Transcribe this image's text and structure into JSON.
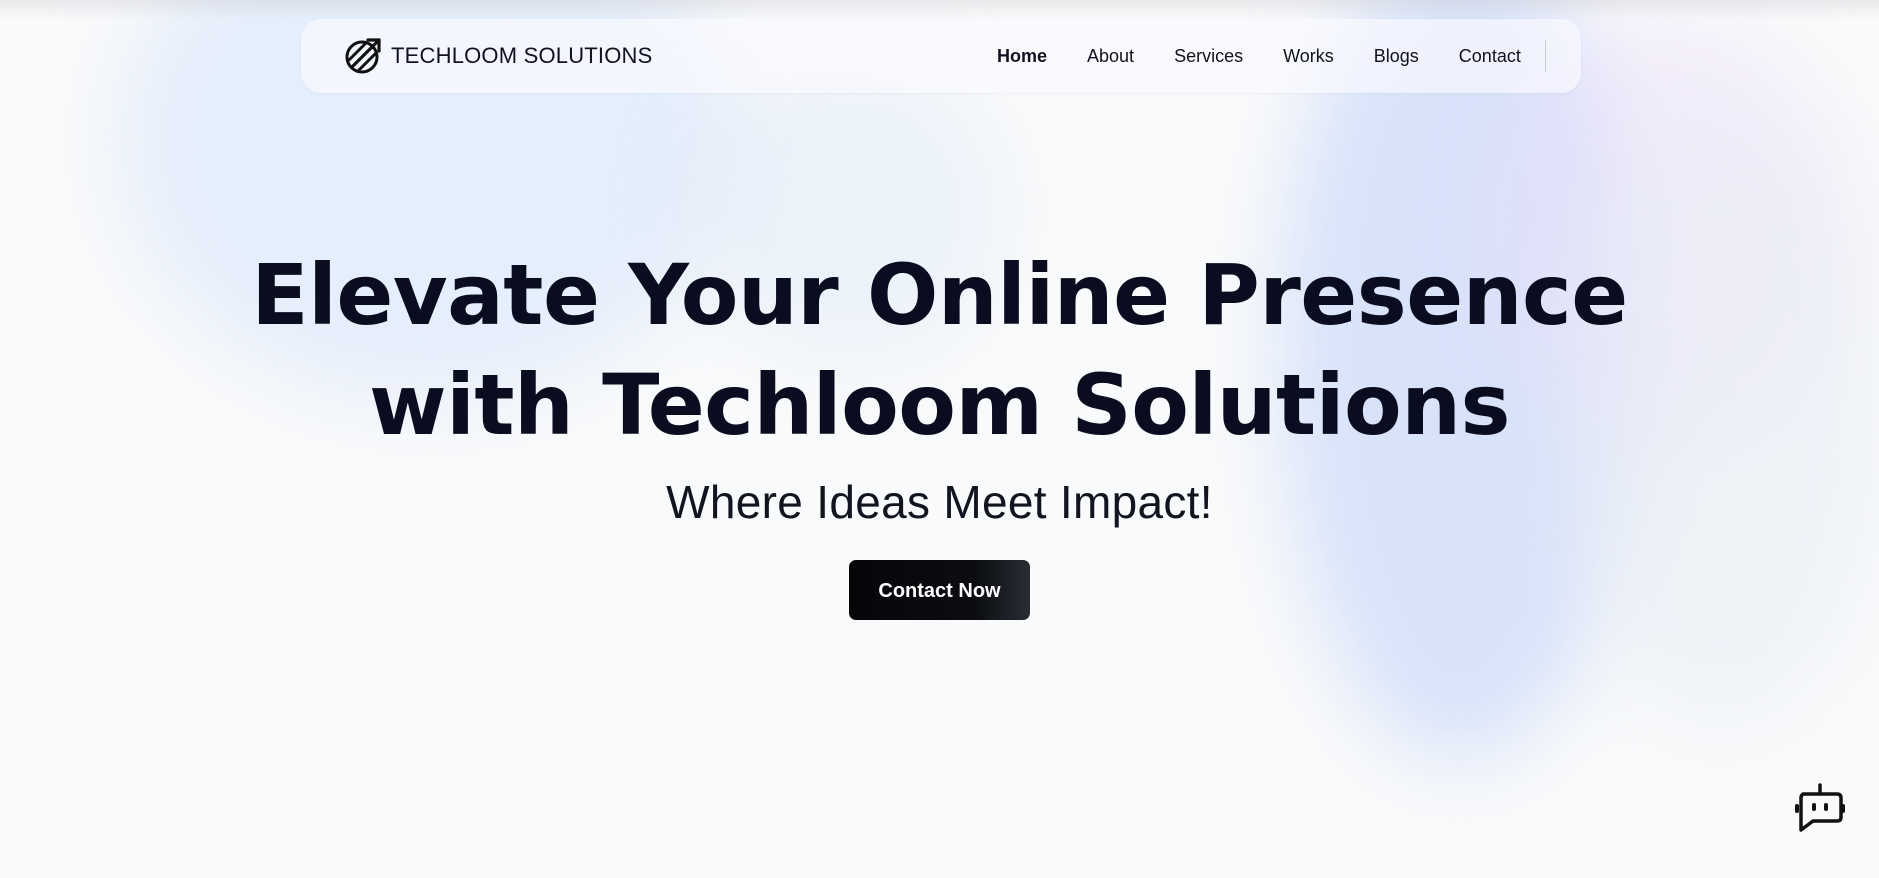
{
  "brand": {
    "name": "TECHLOOM SOLUTIONS",
    "icon": "logo-icon"
  },
  "nav": {
    "items": [
      {
        "label": "Home",
        "active": true
      },
      {
        "label": "About",
        "active": false
      },
      {
        "label": "Services",
        "active": false
      },
      {
        "label": "Works",
        "active": false
      },
      {
        "label": "Blogs",
        "active": false
      },
      {
        "label": "Contact",
        "active": false
      }
    ]
  },
  "hero": {
    "title_line1": "Elevate Your Online Presence",
    "title_line2": "with Techloom Solutions",
    "subtitle": "Where Ideas Meet Impact!",
    "cta_label": "Contact Now"
  },
  "chat": {
    "icon": "chatbot-icon"
  },
  "colors": {
    "text": "#0a0d1f",
    "background": "#f9fafb",
    "cta_background": "#050608",
    "cta_text": "#ffffff"
  }
}
